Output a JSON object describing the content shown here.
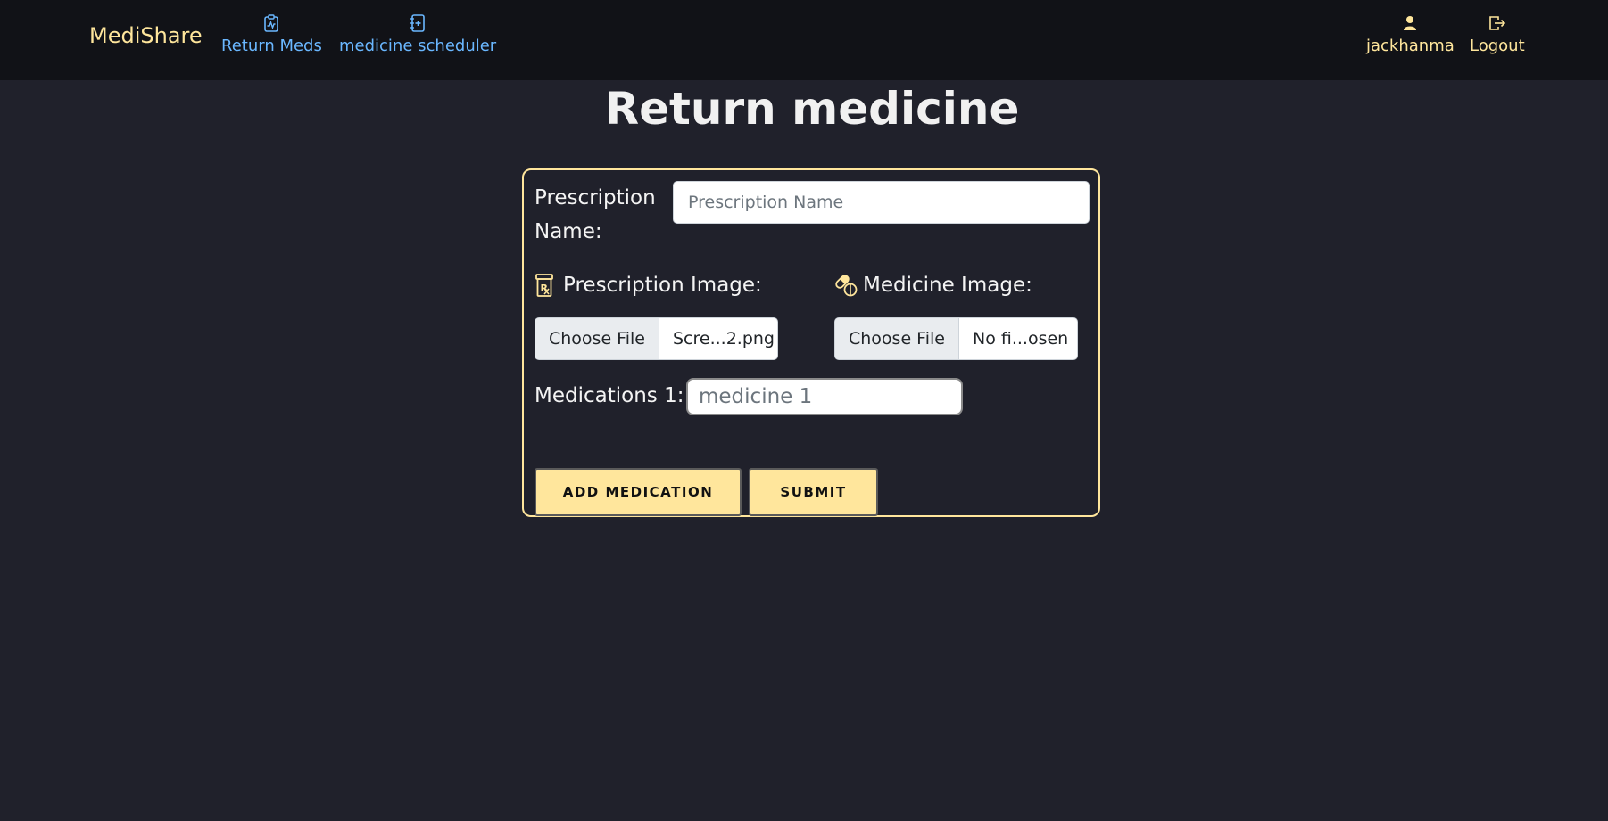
{
  "navbar": {
    "brand": "MediShare",
    "links": [
      {
        "label": "Return Meds",
        "icon": "clipboard-pulse-icon"
      },
      {
        "label": "medicine scheduler",
        "icon": "journal-plus-icon"
      }
    ],
    "user": {
      "label": "jackhanma",
      "icon": "person-icon"
    },
    "logout": {
      "label": "Logout",
      "icon": "box-arrow-right-icon"
    },
    "colors": {
      "brand": "#ffe69c",
      "link": "#6ab7ff",
      "background": "#111217"
    }
  },
  "page": {
    "title": "Return medicine",
    "background": "#20212b",
    "accent": "#ffe69c"
  },
  "form": {
    "prescription_name_label": "Prescription Name:",
    "prescription_name_placeholder": "Prescription Name",
    "prescription_image_label": "Prescription Image:",
    "prescription_image_icon": "prescription-bottle-icon",
    "prescription_file_button": "Choose File",
    "prescription_file_name": "Scre...2.png",
    "medicine_image_label": "Medicine Image:",
    "medicine_image_icon": "capsule-pill-icon",
    "medicine_file_button": "Choose File",
    "medicine_file_name": "No fi...osen",
    "medication_1_label": "Medications 1:",
    "medication_1_placeholder": "medicine 1",
    "add_medication_label": "ADD MEDICATION",
    "submit_label": "SUBMIT"
  }
}
